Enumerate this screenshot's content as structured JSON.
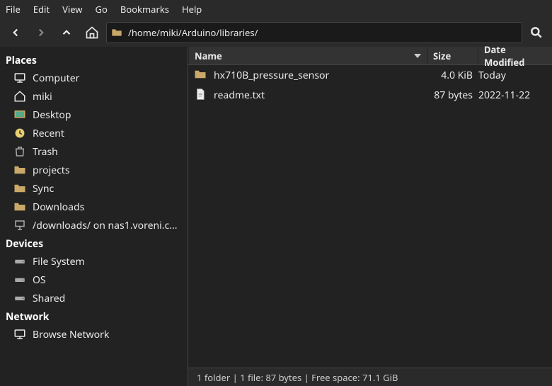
{
  "menu": [
    "File",
    "Edit",
    "View",
    "Go",
    "Bookmarks",
    "Help"
  ],
  "path": "/home/miki/Arduino/libraries/",
  "sidebar": {
    "sections": [
      {
        "title": "Places",
        "items": [
          {
            "icon": "computer",
            "label": "Computer"
          },
          {
            "icon": "home",
            "label": "miki"
          },
          {
            "icon": "desktop",
            "label": "Desktop"
          },
          {
            "icon": "recent",
            "label": "Recent"
          },
          {
            "icon": "trash",
            "label": "Trash"
          },
          {
            "icon": "folder",
            "label": "projects"
          },
          {
            "icon": "folder",
            "label": "Sync"
          },
          {
            "icon": "folder",
            "label": "Downloads"
          },
          {
            "icon": "network-folder",
            "label": "/downloads/ on nas1.voreni.c..."
          }
        ]
      },
      {
        "title": "Devices",
        "items": [
          {
            "icon": "drive",
            "label": "File System"
          },
          {
            "icon": "drive",
            "label": "OS"
          },
          {
            "icon": "drive",
            "label": "Shared"
          }
        ]
      },
      {
        "title": "Network",
        "items": [
          {
            "icon": "network",
            "label": "Browse Network"
          }
        ]
      }
    ]
  },
  "columns": {
    "name": "Name",
    "size": "Size",
    "date": "Date Modified"
  },
  "files": [
    {
      "icon": "folder",
      "name": "hx710B_pressure_sensor",
      "size": "4.0 KiB",
      "date": "Today"
    },
    {
      "icon": "text-file",
      "name": "readme.txt",
      "size": "87 bytes",
      "date": "2022-11-22"
    }
  ],
  "status": "1 folder  |  1 file: 87 bytes  |  Free space: 71.1 GiB"
}
